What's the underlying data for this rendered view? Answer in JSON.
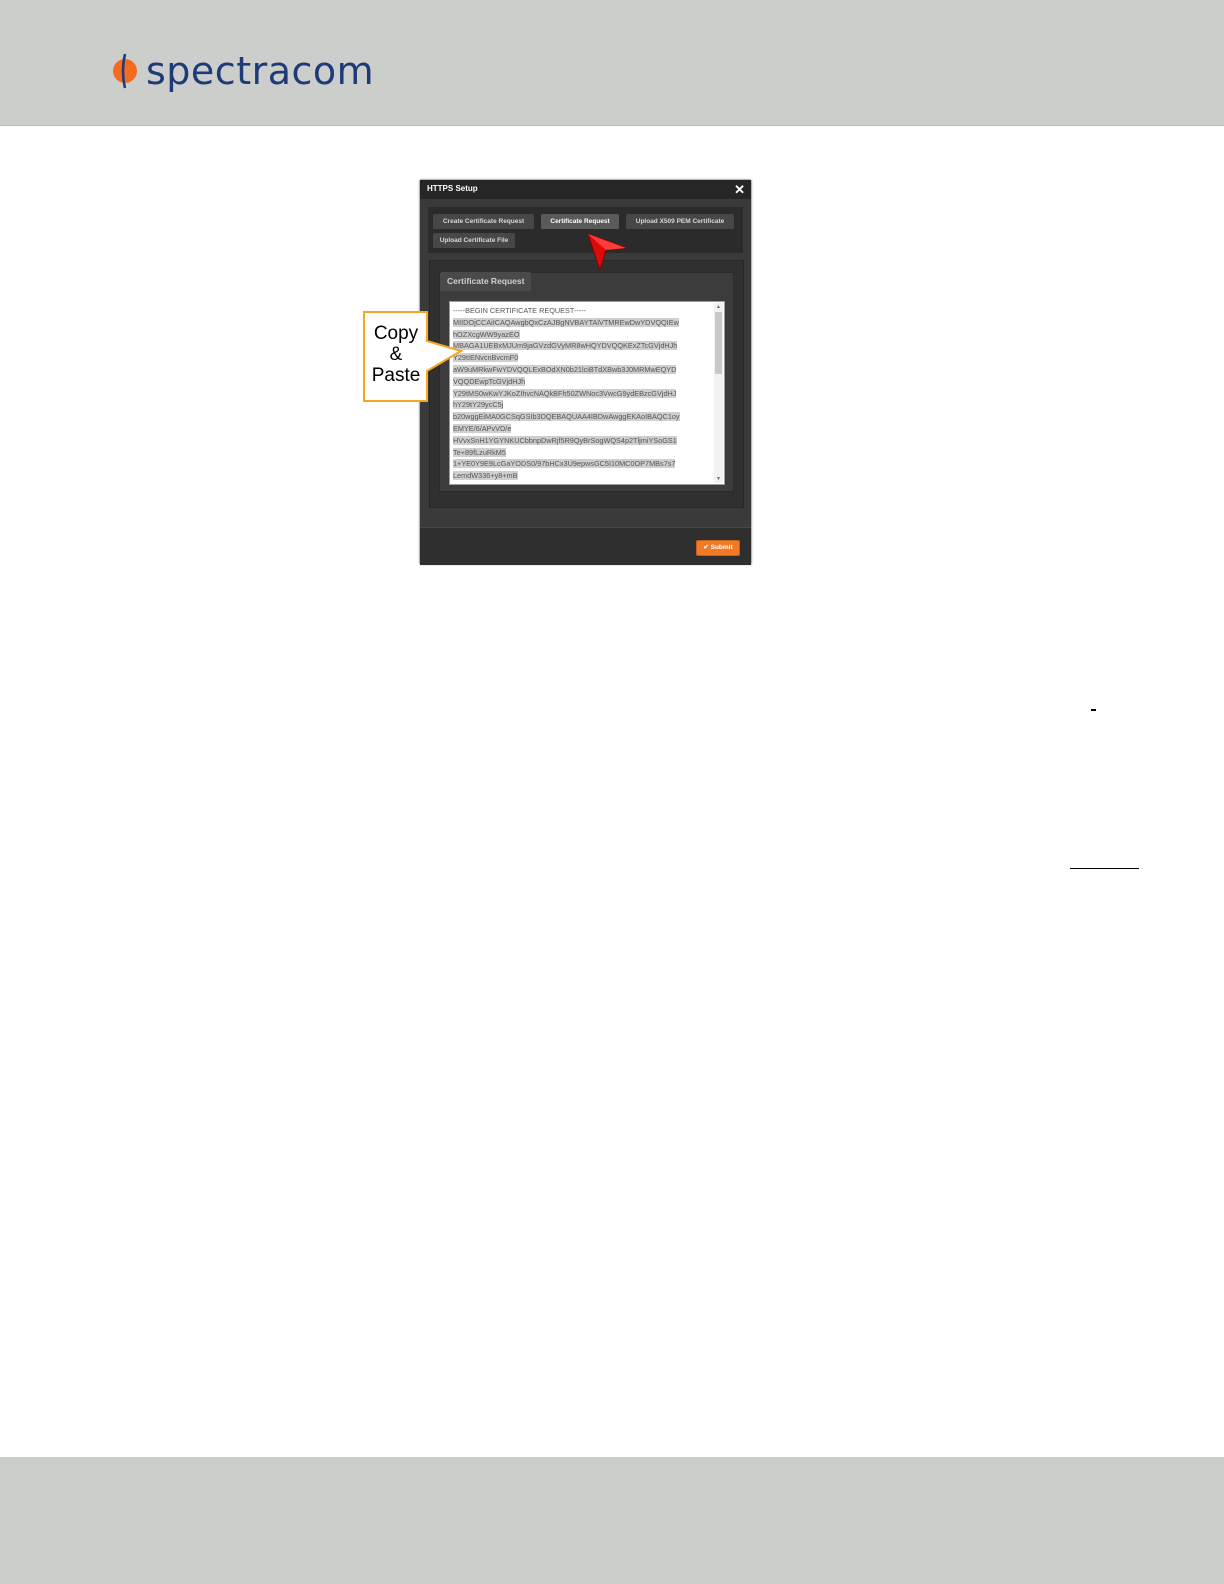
{
  "brand": {
    "name": "spectracom",
    "logo_icon": "spectracom-logo-icon",
    "color": "#1f3a78",
    "accent": "#f26b21"
  },
  "dialog": {
    "title": "HTTPS Setup",
    "close_icon": "close-icon",
    "tabs": [
      {
        "label": "Create Certificate Request",
        "active": false
      },
      {
        "label": "Certificate Request",
        "active": true
      },
      {
        "label": "Upload X509 PEM Certificate",
        "active": false
      },
      {
        "label": "Upload Certificate File",
        "active": false
      }
    ],
    "panel_title": "Certificate Request",
    "certificate_lines": [
      "-----BEGIN CERTIFICATE REQUEST-----",
      "MIIDOjCCAiICAQAwgbQxCzAJBgNVBAYTAlVTMREwDwYDVQQIEw",
      "hOZXcgWW9yazEO",
      "MBAGA1UEBxMJUm9jaGVzdGVyMR8wHQYDVQQKExZTcGVjdHJh",
      "Y29tIENvcnBvcmF0",
      "aW9uMRkwFwYDVQQLExBOdXN0b21lciBTdXBwb3J0MRMwEQYD",
      "VQQDEwpTcGVjdHJh",
      "Y29tMS0wKwYJKoZIhvcNAQkBFh50ZWNoc3VwcG9ydEBzcGVjdHJ",
      "hY29tY29ycC5j",
      "b20wggEiMA0GCSqGSIb3DQEBAQUAA4IBDwAwggEKAoIBAQC1oy",
      "EMYE/6/APvVD/e",
      "HVvxSnH1YGYNKUCbbnpDwRjf5R9QyBrSogWQS4p2TljmiYSoGS1",
      "Te+89fLzuRkM5",
      "1+YE0Y9E9LcGaYODS0/97bHCx3U9epwsGC5I10MC0OP7MBs7s7",
      "LemdW336+y8+mB"
    ],
    "submit_label": "Submit",
    "submit_icon": "checkmark-icon",
    "submit_color": "#f07a26"
  },
  "callout": {
    "line1": "Copy",
    "line2": "&",
    "line3": "Paste",
    "border_color": "#f5a623"
  }
}
